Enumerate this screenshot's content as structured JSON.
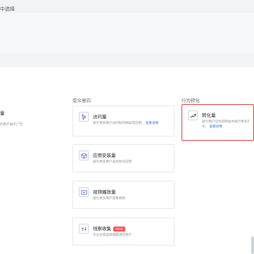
{
  "top": {
    "hint": "中选择"
  },
  "left_column": {
    "title_fragment": "量",
    "desc_fragment": "的用户展示广告"
  },
  "columns": [
    {
      "header": "受众意向",
      "cards": [
        {
          "icon": "cursor-icon",
          "title": "访问量",
          "desc": "吸引更多用户访问你的网站或应用。",
          "link": "查看详情",
          "badge": ""
        },
        {
          "icon": "box-icon",
          "title": "应用安装量",
          "desc": "吸引更多用户安装你的应用",
          "link": "",
          "badge": ""
        },
        {
          "icon": "video-icon",
          "title": "视频播放量",
          "desc": "吸引更多用户观看视频",
          "link": "",
          "badge": ""
        },
        {
          "icon": "lead-icon",
          "title": "线索收集",
          "desc": "为企业或品牌收集潜在客户",
          "link": "",
          "badge": "NEW"
        }
      ]
    },
    {
      "header": "行为转化",
      "cards": [
        {
          "icon": "trend-icon",
          "title": "转化量",
          "desc": "吸引用户在你的网站中执行更多有价值的操",
          "desc2": "作。",
          "link": "查看详情",
          "badge": "",
          "selected": true
        }
      ]
    }
  ],
  "colors": {
    "accent": "#2f6fe0",
    "selected_border": "#e83b3b",
    "badge": "#ff4d4f"
  }
}
